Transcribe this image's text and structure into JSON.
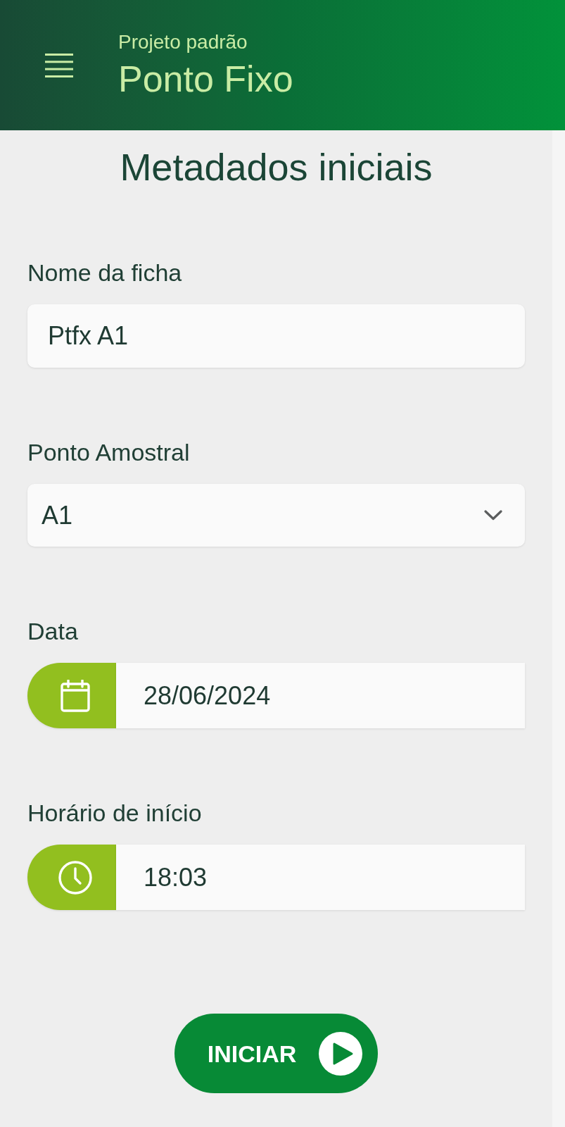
{
  "header": {
    "subtitle": "Projeto padrão",
    "title": "Ponto Fixo"
  },
  "page_title": "Metadados iniciais",
  "fields": [
    {
      "kind": "text",
      "label": "Nome da ficha",
      "value": "Ptfx A1"
    },
    {
      "kind": "select",
      "label": "Ponto Amostral",
      "value": "A1"
    },
    {
      "kind": "date",
      "label": "Data",
      "value": "28/06/2024"
    },
    {
      "kind": "time",
      "label": "Horário de início",
      "value": "18:03"
    }
  ],
  "primary_button": {
    "label": "INICIAR"
  }
}
